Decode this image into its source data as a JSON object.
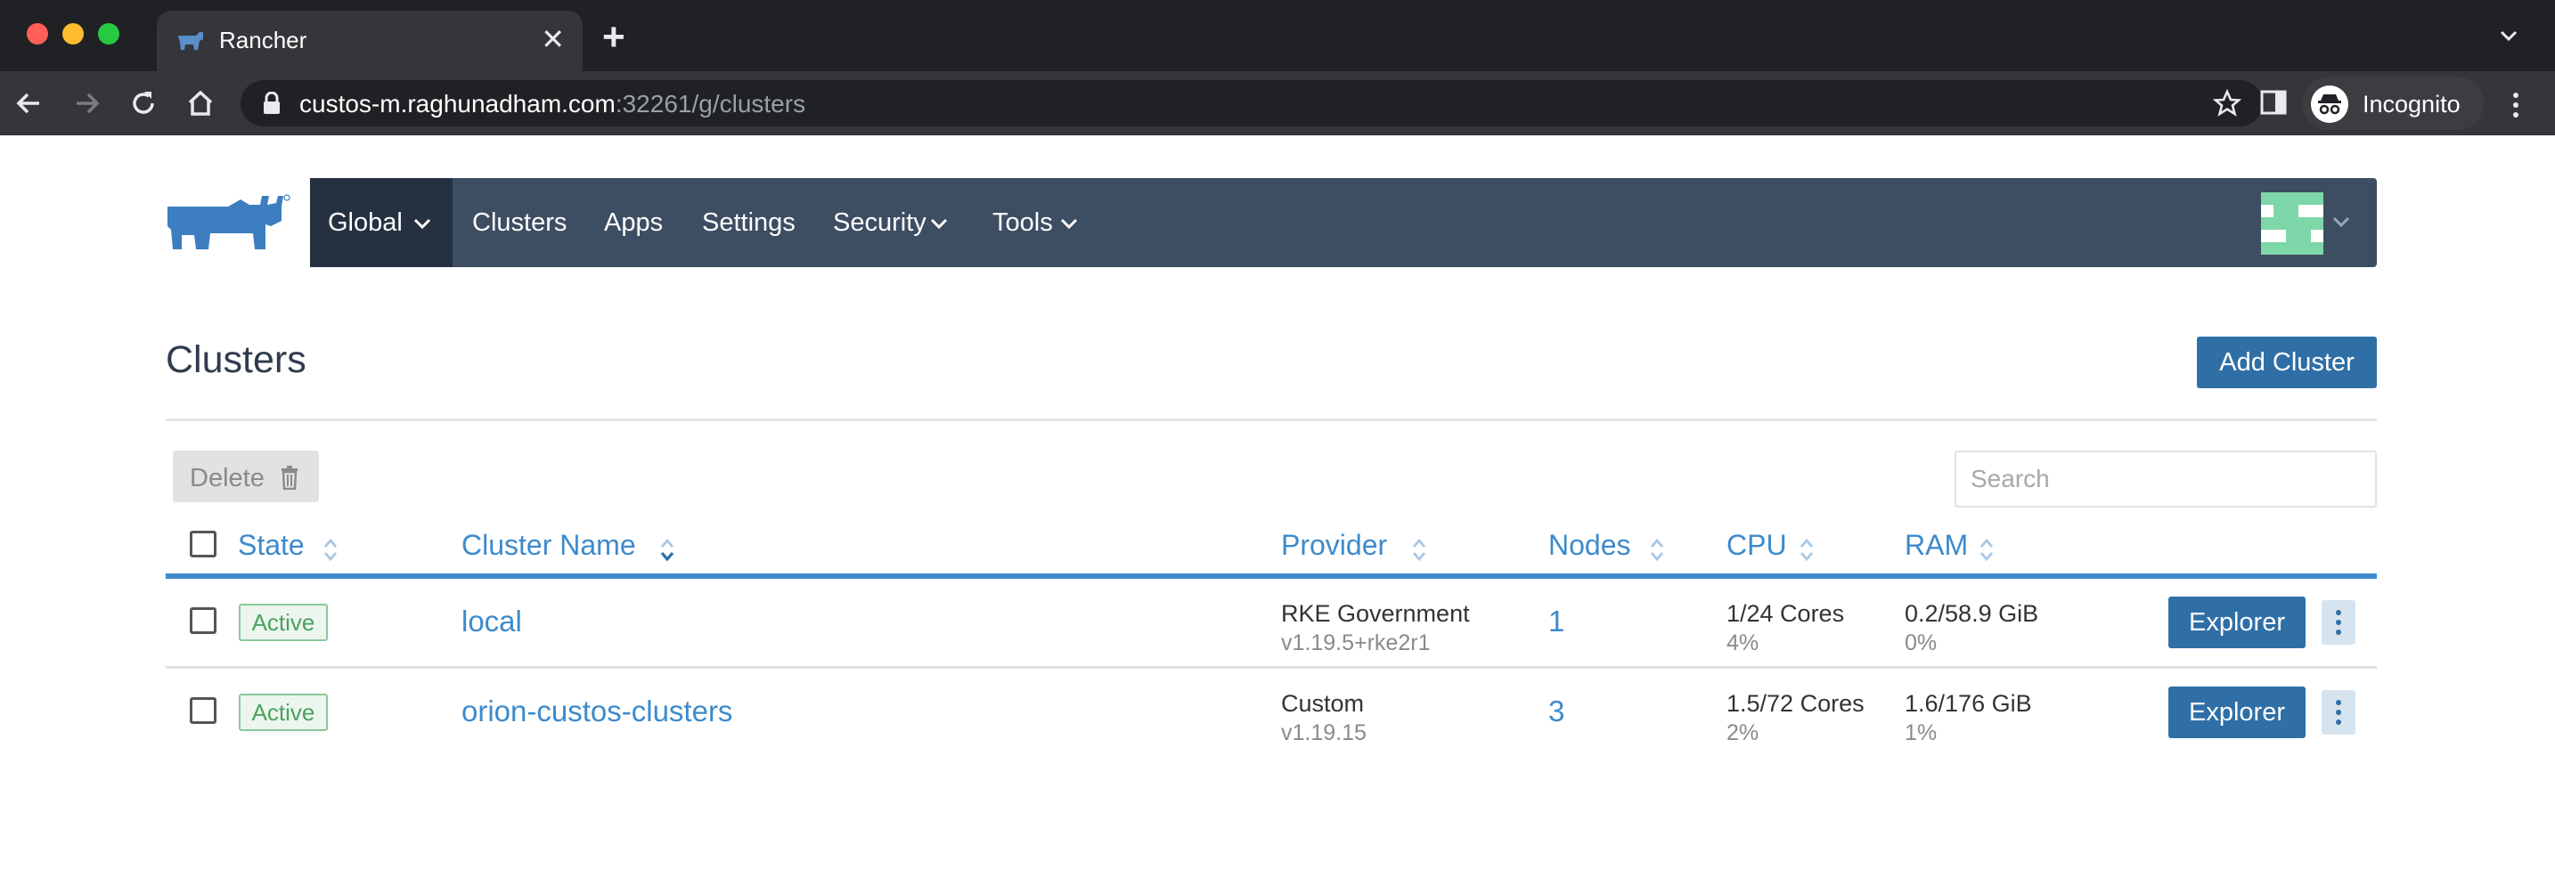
{
  "browser": {
    "tab_title": "Rancher",
    "tab_close": "✕",
    "new_tab": "+",
    "url_host": "custos-m.raghunadham.com",
    "url_path": ":32261/g/clusters",
    "profile_label": "Incognito"
  },
  "nav": {
    "items": [
      "Global",
      "Clusters",
      "Apps",
      "Settings",
      "Security",
      "Tools"
    ]
  },
  "page": {
    "title": "Clusters",
    "add_button": "Add Cluster"
  },
  "toolbar": {
    "delete_label": "Delete",
    "search_placeholder": "Search"
  },
  "table": {
    "columns": [
      "State",
      "Cluster Name",
      "Provider",
      "Nodes",
      "CPU",
      "RAM"
    ],
    "rows": [
      {
        "state": "Active",
        "name": "local",
        "provider": "RKE Government",
        "provider_version": "v1.19.5+rke2r1",
        "nodes": "1",
        "cpu": "1/24 Cores",
        "cpu_pct": "4%",
        "ram": "0.2/58.9 GiB",
        "ram_pct": "0%",
        "action": "Explorer"
      },
      {
        "state": "Active",
        "name": "orion-custos-clusters",
        "provider": "Custom",
        "provider_version": "v1.19.15",
        "nodes": "3",
        "cpu": "1.5/72 Cores",
        "cpu_pct": "2%",
        "ram": "1.6/176 GiB",
        "ram_pct": "1%",
        "action": "Explorer"
      }
    ]
  },
  "icons": {
    "browser": [
      "back-icon",
      "forward-icon",
      "reload-icon",
      "home-icon",
      "lock-icon",
      "star-icon",
      "side-panel-icon",
      "incognito-icon",
      "more-icon"
    ],
    "app": [
      "rancher-logo",
      "chevron-down-icon",
      "trash-icon",
      "sort-icon",
      "kebab-icon"
    ]
  },
  "colors": {
    "navbar": "#3d4d62",
    "navbar_active": "#253140",
    "primary": "#2f6fa6",
    "link": "#3d8acc",
    "active_badge": "#4aa260"
  }
}
